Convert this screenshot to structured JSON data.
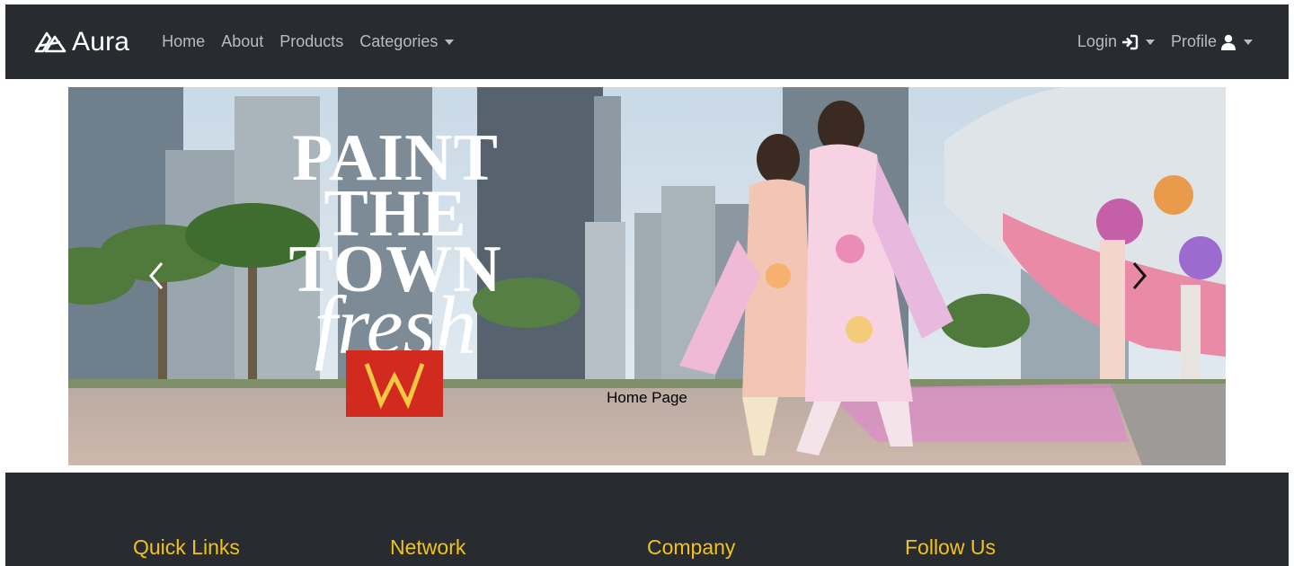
{
  "navbar": {
    "brand": "Aura",
    "links": [
      "Home",
      "About",
      "Products",
      "Categories"
    ],
    "login": "Login",
    "profile": "Profile"
  },
  "carousel": {
    "headline": [
      "PAINT",
      "THE",
      "TOWN",
      "fresh"
    ],
    "caption": "Home Page",
    "logo_letter": "W"
  },
  "footer": {
    "columns": [
      "Quick Links",
      "Network",
      "Company",
      "Follow Us"
    ]
  },
  "colors": {
    "navbar_bg": "#282c31",
    "footer_heading": "#f2c21b",
    "nav_link": "#b8bcc1"
  }
}
